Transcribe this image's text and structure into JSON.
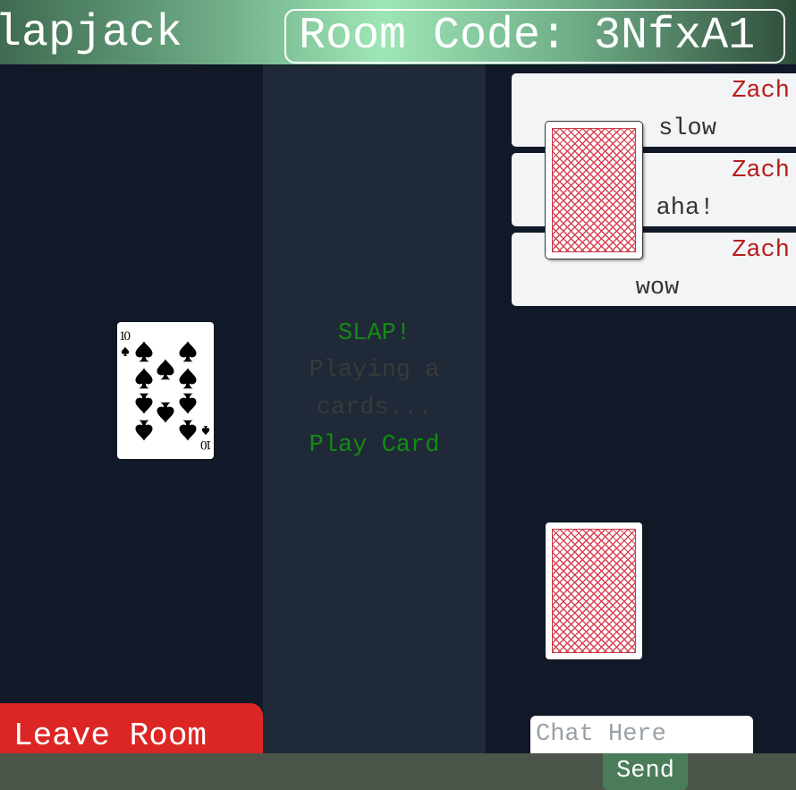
{
  "header": {
    "title": "lapjack",
    "room_code": "Room Code: 3NfxA1"
  },
  "played_card": {
    "rank": "10",
    "suit": "♠"
  },
  "actions": {
    "slap_label": "SLAP!",
    "status_text": "Playing a cards...",
    "play_card_label": "Play Card"
  },
  "chat": {
    "messages": [
      {
        "author": "Zach",
        "text": "slow"
      },
      {
        "author": "Zach",
        "text": "aha!"
      },
      {
        "author": "Zach",
        "text": "wow"
      }
    ],
    "input_placeholder": "Chat Here",
    "send_label": "Send"
  },
  "leave_label": "Leave Room",
  "colors": {
    "accent_green": "#138a13",
    "leave_red": "#dc2626",
    "author_red": "#b91c1c",
    "send_green": "#4a7c59"
  }
}
